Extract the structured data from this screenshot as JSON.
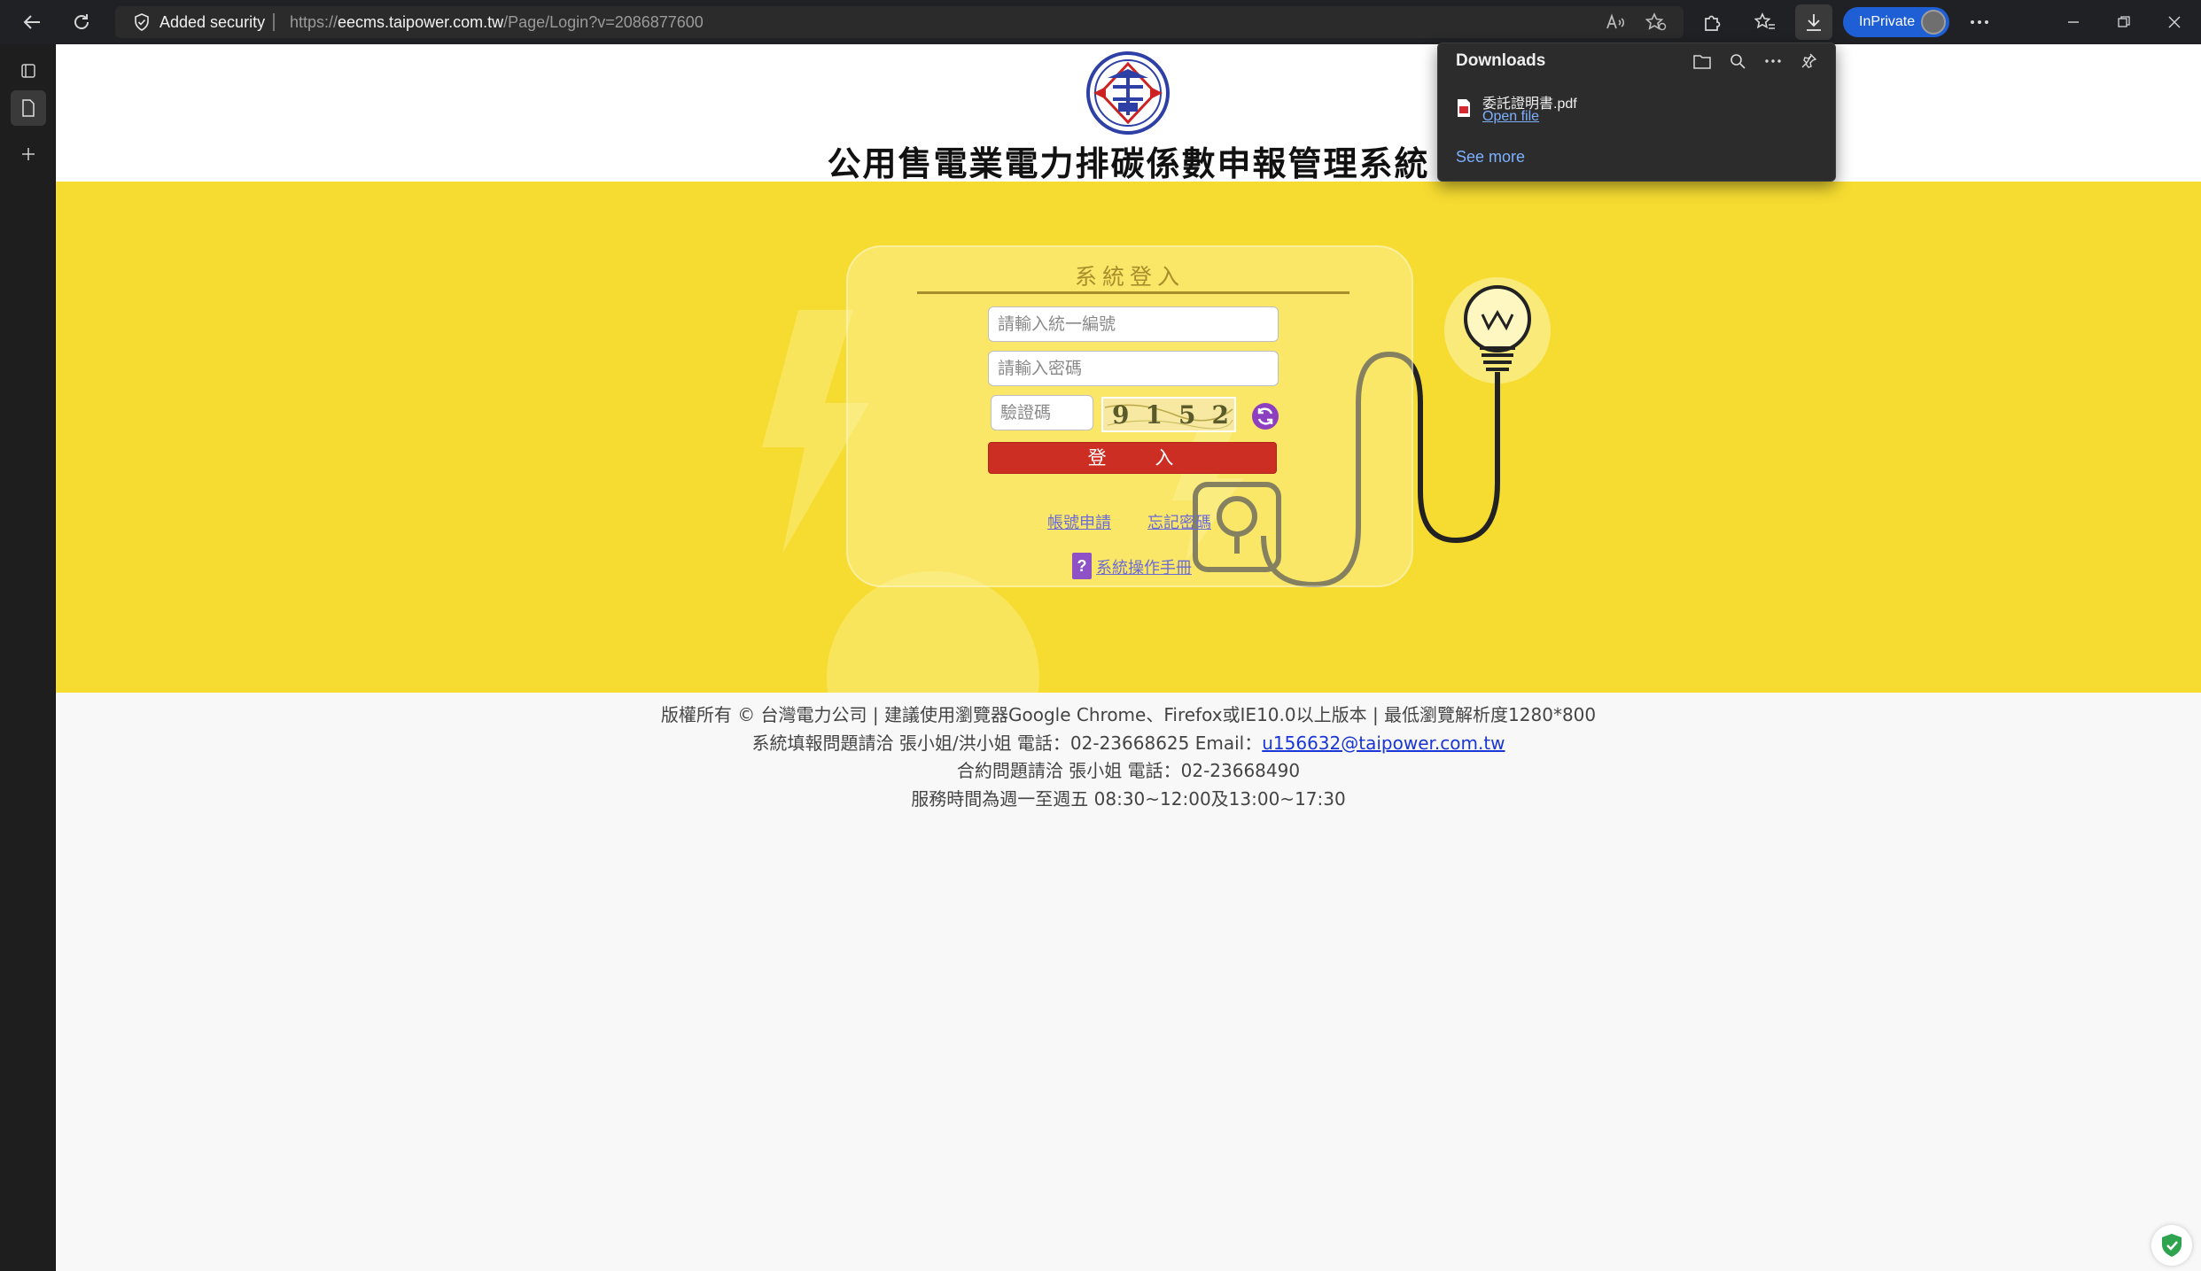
{
  "browser": {
    "security_label": "Added security",
    "url_prefix": "https://",
    "url_host": "eecms.taipower.com.tw",
    "url_path": "/Page/Login?v=2086877600",
    "inprivate_label": "InPrivate"
  },
  "downloads": {
    "title": "Downloads",
    "file_name": "委託證明書.pdf",
    "open_file": "Open file",
    "see_more": "See more"
  },
  "site": {
    "title": "公用售電業電力排碳係數申報管理系統"
  },
  "login": {
    "heading": "系統登入",
    "id_placeholder": "請輸入統一編號",
    "password_placeholder": "請輸入密碼",
    "captcha_placeholder": "驗證碼",
    "captcha_code": "9152",
    "login_button": "登 入",
    "apply_link": "帳號申請",
    "forgot_link": "忘記密碼",
    "manual_icon_text": "?",
    "manual_link": "系統操作手冊"
  },
  "footer": {
    "line1": "版權所有 © 台灣電力公司 | 建議使用瀏覽器Google Chrome、Firefox或IE10.0以上版本 | 最低瀏覽解析度1280*800",
    "line2_text": "系統填報問題請洽 張小姐/洪小姐 電話：02-23668625 Email：",
    "line2_email": "u156632@taipower.com.tw",
    "line3": "合約問題請洽 張小姐 電話：02-23668490",
    "line4": "服務時間為週一至週五 08:30~12:00及13:00~17:30"
  },
  "colors": {
    "banner": "#f6dc31",
    "login_button": "#cc2e24",
    "link": "#6b6bd6",
    "footer_link": "#1a35d6",
    "inprivate": "#1f5fd6"
  },
  "icons": {
    "back": "arrow-left-icon",
    "refresh": "refresh-icon",
    "shield": "shield-icon",
    "read_aloud": "read-aloud-icon",
    "favorite_add": "star-plus-icon",
    "extensions": "puzzle-icon",
    "favorites": "favorites-icon",
    "download": "download-icon",
    "more": "ellipsis-icon"
  }
}
